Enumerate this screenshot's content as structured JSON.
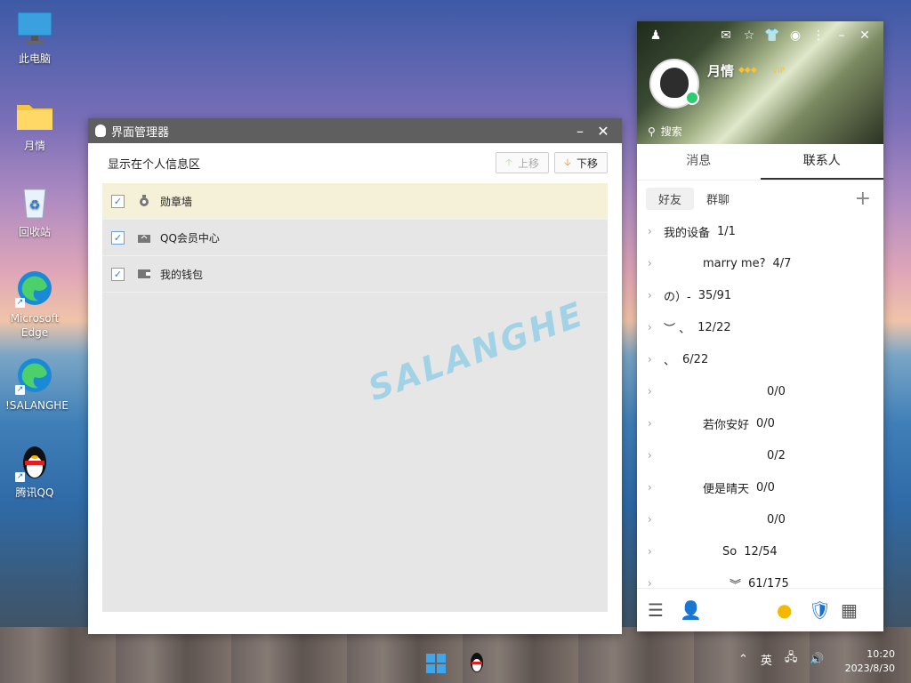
{
  "desktop": {
    "icons": [
      {
        "label": "此电脑",
        "icon": "computer-icon"
      },
      {
        "label": "月情",
        "icon": "folder-icon"
      },
      {
        "label": "回收站",
        "icon": "recycle-bin-icon"
      },
      {
        "label": "Microsoft Edge",
        "icon": "edge-icon"
      },
      {
        "label": "!SALANGHE",
        "icon": "edge-icon"
      },
      {
        "label": "腾讯QQ",
        "icon": "qq-penguin-icon"
      }
    ]
  },
  "manager": {
    "title": "界面管理器",
    "caption": "显示在个人信息区",
    "up_label": "上移",
    "down_label": "下移",
    "items": [
      {
        "label": "勋章墙",
        "checked": true,
        "icon": "medal-icon"
      },
      {
        "label": "QQ会员中心",
        "checked": true,
        "icon": "crown-bag-icon"
      },
      {
        "label": "我的钱包",
        "checked": true,
        "icon": "wallet-icon"
      }
    ],
    "watermark": "SALANGHE"
  },
  "qq": {
    "nickname": "月情",
    "vip_badge": "VIP",
    "search_placeholder": "搜索",
    "tabs": [
      "消息",
      "联系人"
    ],
    "active_tab": "联系人",
    "subtabs": [
      "好友",
      "群聊"
    ],
    "groups": [
      {
        "name": "我的设备",
        "count": "1/1"
      },
      {
        "name": "marry me?",
        "count": "4/7"
      },
      {
        "name": "の）-",
        "count": "35/91"
      },
      {
        "name": "︶ 、",
        "count": "12/22"
      },
      {
        "name": "、",
        "count": "6/22"
      },
      {
        "name": "",
        "count": "0/0"
      },
      {
        "name": "若你安好",
        "count": "0/0"
      },
      {
        "name": "",
        "count": "0/2"
      },
      {
        "name": "便是晴天",
        "count": "0/0"
      },
      {
        "name": "",
        "count": "0/0"
      },
      {
        "name": "So",
        "count": "12/54"
      },
      {
        "name": "︾",
        "count": "61/175"
      }
    ]
  },
  "taskbar": {
    "ime": "英",
    "time": "10:20",
    "date": "2023/8/30"
  },
  "colors": {
    "title_bar": "#5f5f5f",
    "selected_row": "#f5f0d8",
    "accent_blue": "#3a7bd5"
  }
}
